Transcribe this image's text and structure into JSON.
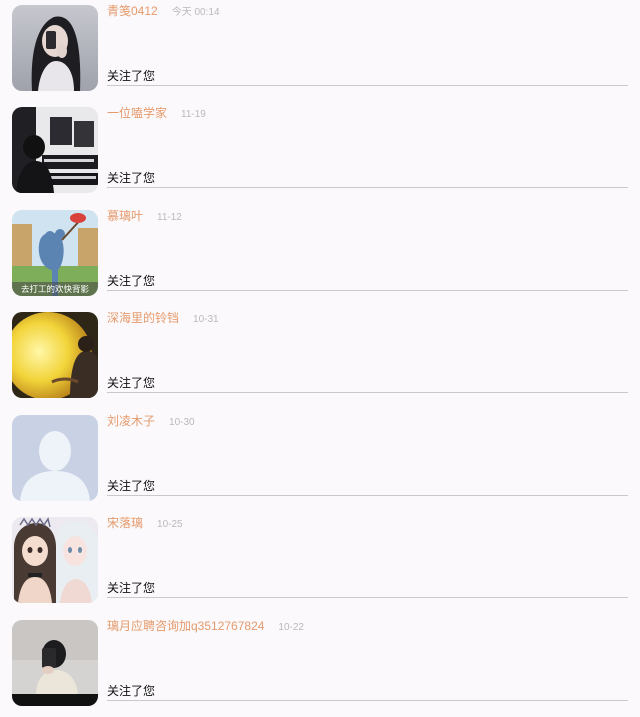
{
  "notifications": [
    {
      "name": "青笺0412",
      "time": "今天 00:14",
      "action": "关注了您",
      "avatar": "selfie-photo-icon"
    },
    {
      "name": "一位嗑学家",
      "time": "11-19",
      "action": "关注了您",
      "avatar": "music-studio-photo-icon"
    },
    {
      "name": "慕璃叶",
      "time": "11-12",
      "action": "关注了您",
      "avatar": "cartoon-cat-icon",
      "avatar_caption": "去打工的欢快背影"
    },
    {
      "name": "深海里的铃铛",
      "time": "10-31",
      "action": "关注了您",
      "avatar": "moon-illustration-icon"
    },
    {
      "name": "刘凌木子",
      "time": "10-30",
      "action": "关注了您",
      "avatar": "default-user-icon"
    },
    {
      "name": "宋落璃",
      "time": "10-25",
      "action": "关注了您",
      "avatar": "anime-girls-icon"
    },
    {
      "name": "璃月应聘咨询加q3512767824",
      "time": "10-22",
      "action": "关注了您",
      "avatar": "mirror-selfie-icon"
    }
  ],
  "colors": {
    "name": "#e59a6c",
    "time": "#b9b9bd",
    "background": "#fbf9fb",
    "divider": "#c9c9cc"
  }
}
